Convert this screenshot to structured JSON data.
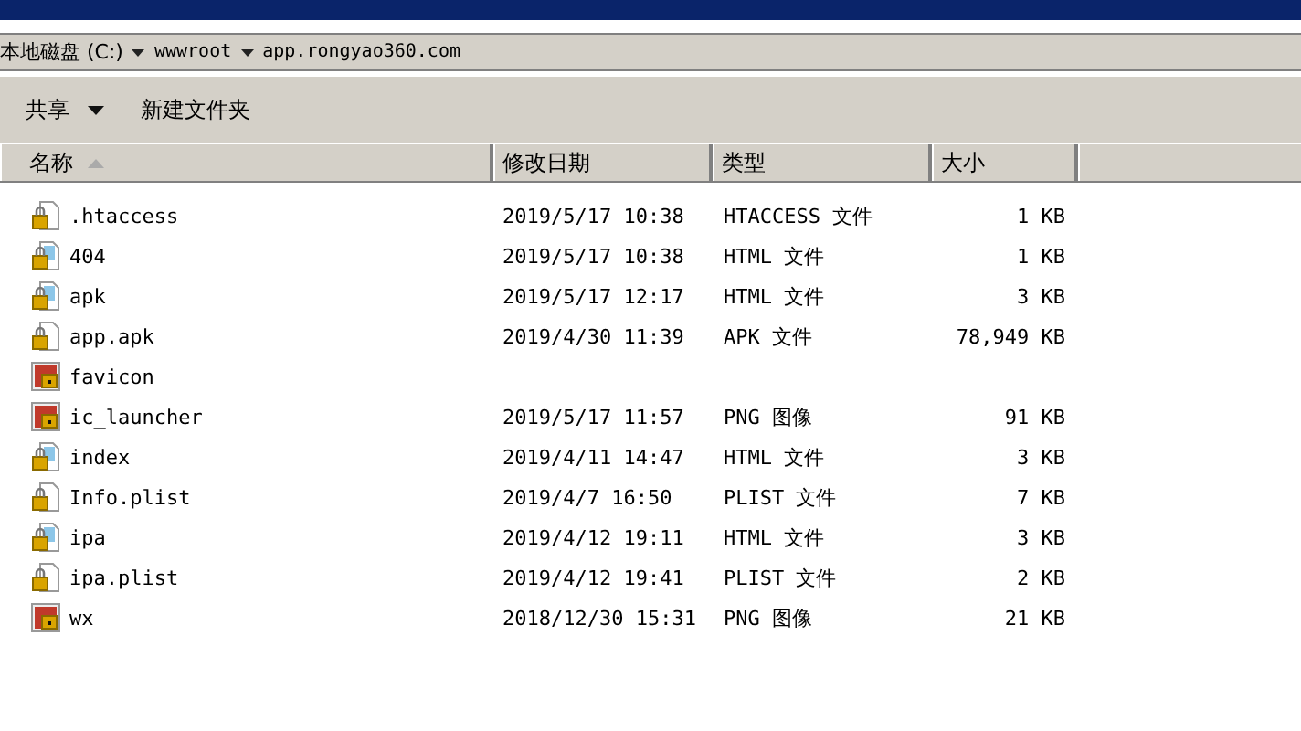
{
  "address_bar": {
    "segments": [
      "本地磁盘 (C:)",
      "wwwroot",
      "app.rongyao360.com"
    ]
  },
  "toolbar": {
    "items": [
      {
        "label": "共享",
        "dropdown": true
      },
      {
        "label": "新建文件夹",
        "dropdown": false
      }
    ]
  },
  "table": {
    "columns": [
      {
        "label": "名称",
        "sorted": true
      },
      {
        "label": "修改日期",
        "sorted": false
      },
      {
        "label": "类型",
        "sorted": false
      },
      {
        "label": "大小",
        "sorted": false
      }
    ],
    "rows": [
      {
        "kind": "doc",
        "name": ".htaccess",
        "date": "2019/5/17 10:38",
        "type": "HTACCESS 文件",
        "size": "1 KB"
      },
      {
        "kind": "html",
        "name": "404",
        "date": "2019/5/17 10:38",
        "type": "HTML 文件",
        "size": "1 KB"
      },
      {
        "kind": "html",
        "name": "apk",
        "date": "2019/5/17 12:17",
        "type": "HTML 文件",
        "size": "3 KB"
      },
      {
        "kind": "doc",
        "name": "app.apk",
        "date": "2019/4/30 11:39",
        "type": "APK 文件",
        "size": "78,949 KB"
      },
      {
        "kind": "image",
        "name": "favicon"
      },
      {
        "kind": "image",
        "name": "ic_launcher",
        "date": "2019/5/17 11:57",
        "type": "PNG 图像",
        "size": "91 KB"
      },
      {
        "kind": "html",
        "name": "index",
        "date": "2019/4/11 14:47",
        "type": "HTML 文件",
        "size": "3 KB"
      },
      {
        "kind": "doc",
        "name": "Info.plist",
        "date": "2019/4/7 16:50",
        "type": "PLIST 文件",
        "size": "7 KB"
      },
      {
        "kind": "html",
        "name": "ipa",
        "date": "2019/4/12 19:11",
        "type": "HTML 文件",
        "size": "3 KB"
      },
      {
        "kind": "doc",
        "name": "ipa.plist",
        "date": "2019/4/12 19:41",
        "type": "PLIST 文件",
        "size": "2 KB"
      },
      {
        "kind": "image",
        "name": "wx",
        "date": "2018/12/30 15:31",
        "type": "PNG 图像",
        "size": "21 KB"
      }
    ]
  }
}
